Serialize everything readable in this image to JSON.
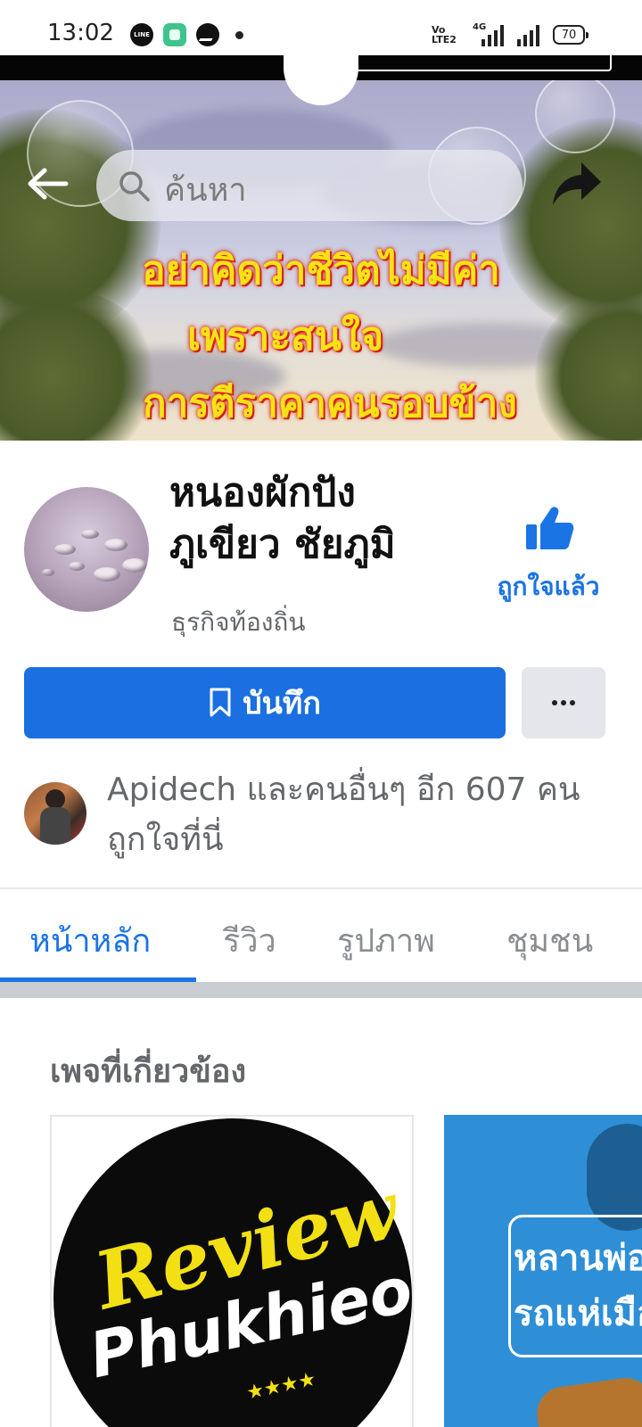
{
  "status_bar": {
    "time": "13:02",
    "volte_label": "Vo LTE2",
    "network_label": "4G",
    "battery": "70",
    "app_icons": [
      "line-icon",
      "app-square-icon",
      "messenger-icon",
      "notification-dot-icon"
    ]
  },
  "header": {
    "search_placeholder": "ค้นหา"
  },
  "cover": {
    "quote_lines": [
      "อย่าคิดว่าชีวิตไม่มีค่า",
      "เพราะสนใจ",
      "การตีราคาคนรอบข้าง"
    ]
  },
  "profile": {
    "name": "หนองผักปัง ภูเขียว ชัยภูมิ",
    "category": "ธุรกิจท้องถิ่น",
    "liked_label": "ถูกใจแล้ว"
  },
  "actions": {
    "save_label": "บันทึก"
  },
  "likes": {
    "text": "Apidech และคนอื่นๆ อีก 607 คนถูกใจที่นี่"
  },
  "tabs": [
    {
      "label": "หน้าหลัก",
      "active": true
    },
    {
      "label": "รีวิว",
      "active": false
    },
    {
      "label": "รูปภาพ",
      "active": false
    },
    {
      "label": "ชุมชน",
      "active": false
    }
  ],
  "related": {
    "title": "เพจที่เกี่ยวข้อง",
    "cards": [
      {
        "logo_line1": "Review",
        "logo_line2": "Phukhieo"
      },
      {
        "logo_line1": "หลานพ่อ",
        "logo_line2": "รถแห่เมือ"
      }
    ]
  },
  "colors": {
    "accent": "#1b74e4",
    "save_button": "#1b6fe0",
    "quote_text": "#f5e316"
  }
}
